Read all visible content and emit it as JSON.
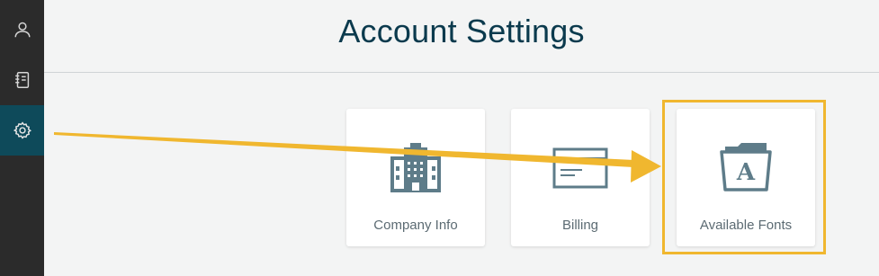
{
  "sidebar": {
    "items": [
      {
        "icon": "user-icon"
      },
      {
        "icon": "notebook-icon"
      },
      {
        "icon": "gear-icon",
        "active": true
      }
    ]
  },
  "header": {
    "title": "Account Settings"
  },
  "cards": [
    {
      "label": "Company Info",
      "icon": "building-icon"
    },
    {
      "label": "Billing",
      "icon": "credit-card-icon"
    },
    {
      "label": "Available Fonts",
      "icon": "font-folder-icon"
    }
  ],
  "colors": {
    "sidebar": "#2b2b2b",
    "sidebar_active": "#0e4a5a",
    "title": "#0b3a4d",
    "icon": "#5e7c89",
    "highlight": "#f0b72f"
  }
}
